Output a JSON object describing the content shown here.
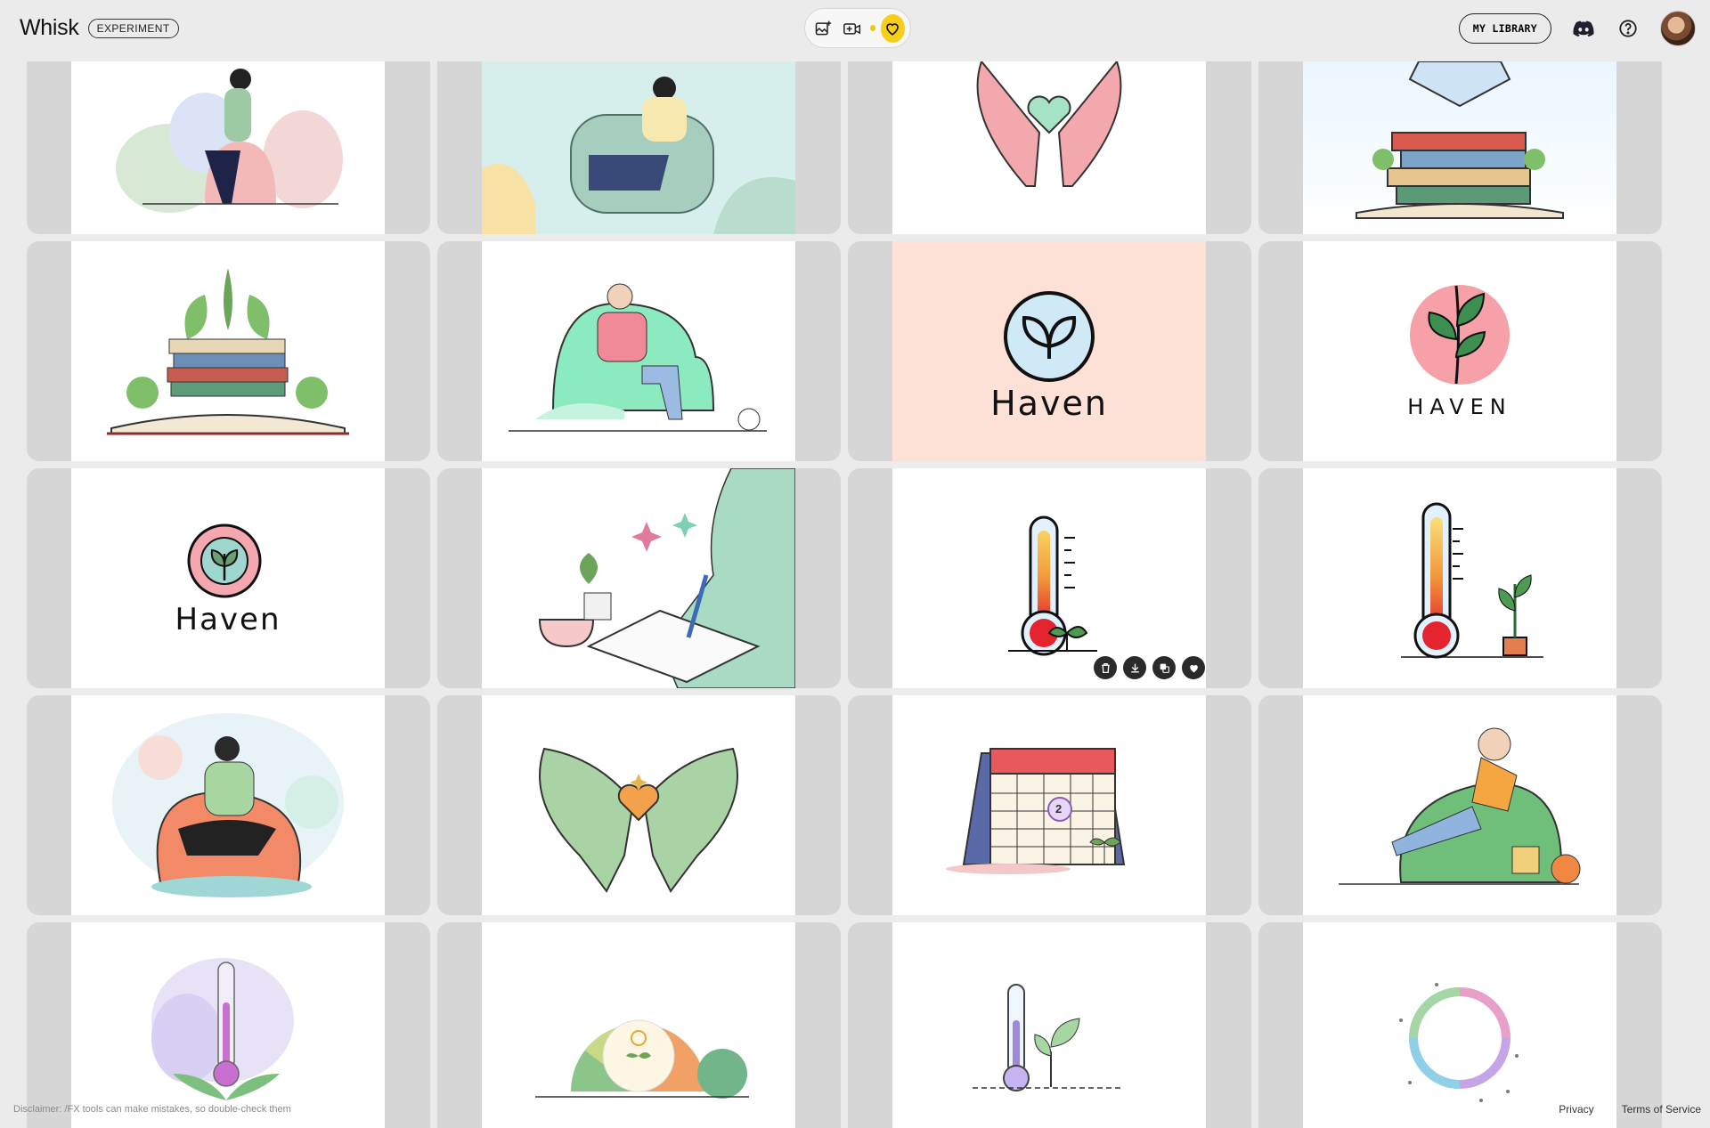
{
  "app": {
    "title": "Whisk",
    "badge": "EXPERIMENT",
    "accent_color": "#f7cf1b"
  },
  "header": {
    "tools": [
      {
        "name": "image-add",
        "icon": "image-plus-icon"
      },
      {
        "name": "video",
        "icon": "video-plus-icon"
      },
      {
        "name": "favorites",
        "icon": "heart-icon",
        "active": true
      }
    ],
    "library_label": "MY LIBRARY",
    "discord_icon": "discord-icon",
    "help_icon": "help-icon"
  },
  "gallery": {
    "cards": [
      {
        "subject": "woman-in-armchair-lineart"
      },
      {
        "subject": "woman-in-armchair-mint"
      },
      {
        "subject": "hands-heart-pink"
      },
      {
        "subject": "open-book-plants"
      },
      {
        "subject": "book-stack-plants"
      },
      {
        "subject": "man-in-beanbag"
      },
      {
        "subject": "haven-logo-leaf-circle",
        "logo_text": "Haven"
      },
      {
        "subject": "haven-logo-pink-circle",
        "logo_text": "HAVEN"
      },
      {
        "subject": "haven-logo-ring",
        "logo_text": "Haven"
      },
      {
        "subject": "journaling-tea"
      },
      {
        "subject": "thermometer-sprout",
        "hover_actions": [
          "delete-icon",
          "download-icon",
          "reuse-icon",
          "heart-icon"
        ]
      },
      {
        "subject": "thermometer-potted-plant"
      },
      {
        "subject": "woman-orange-beanbag"
      },
      {
        "subject": "green-hands-heart"
      },
      {
        "subject": "calendar-sprout",
        "calendar_day": "2"
      },
      {
        "subject": "man-relaxing-beanbag"
      },
      {
        "subject": "thermometer-leaves"
      },
      {
        "subject": "color-wheel-sun"
      },
      {
        "subject": "thermometer-small-sprout"
      },
      {
        "subject": "rainbow-ring"
      }
    ]
  },
  "footer": {
    "disclaimer": "Disclaimer: /FX tools can make mistakes, so double-check them",
    "privacy": "Privacy",
    "terms": "Terms of Service"
  }
}
